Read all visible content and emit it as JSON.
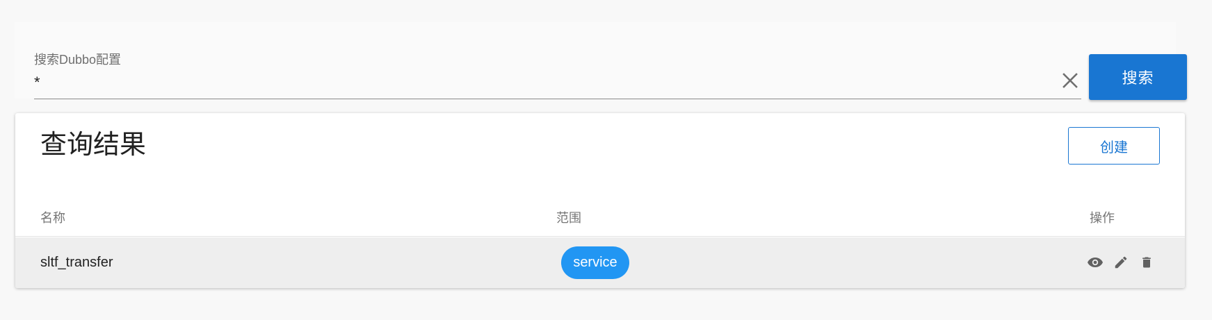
{
  "search": {
    "label": "搜索Dubbo配置",
    "value": "*",
    "clear_icon": "close-icon",
    "button_label": "搜索"
  },
  "results": {
    "title": "查询结果",
    "create_label": "创建",
    "columns": {
      "name": "名称",
      "scope": "范围",
      "actions": "操作"
    },
    "rows": [
      {
        "name": "sltf_transfer",
        "scope": "service",
        "actions": [
          "eye-icon",
          "pencil-icon",
          "trash-icon"
        ]
      }
    ]
  },
  "colors": {
    "primary": "#1976d2",
    "chip": "#2196f3",
    "row_bg": "#eeeeee"
  }
}
